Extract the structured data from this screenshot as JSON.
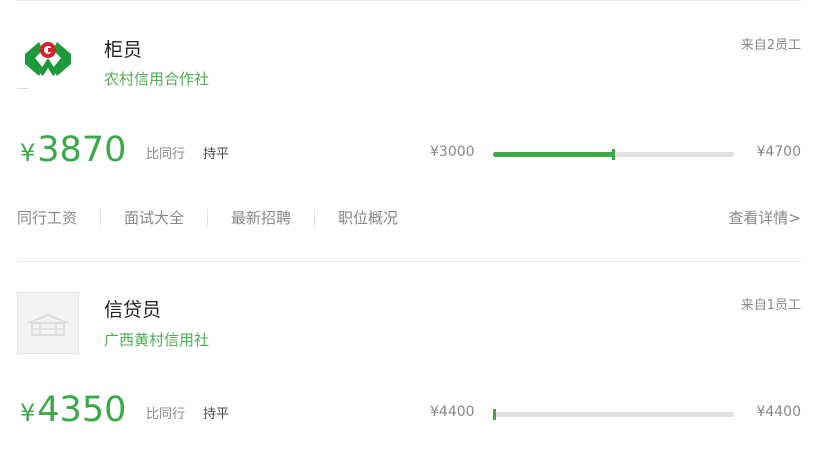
{
  "cards": [
    {
      "title": "柜员",
      "company": "农村信用合作社",
      "source": "来自2员工",
      "logo_icon": "rural-credit-cooperative-logo",
      "currency": "¥",
      "salary": "3870",
      "compare_label": "比同行",
      "compare_value": "持平",
      "range_min": "¥3000",
      "range_max": "¥4700",
      "range_fraction": 0.5,
      "links": [
        "同行工资",
        "面试大全",
        "最新招聘",
        "职位概况"
      ],
      "detail_label": "查看详情>"
    },
    {
      "title": "信贷员",
      "company": "广西黄村信用社",
      "source": "来自1员工",
      "logo_icon": "building-placeholder-icon",
      "currency": "¥",
      "salary": "4350",
      "compare_label": "比同行",
      "compare_value": "持平",
      "range_min": "¥4400",
      "range_max": "¥4400",
      "range_fraction": 0.0
    }
  ],
  "colors": {
    "accent": "#3aaa48",
    "company": "#4caf50",
    "muted": "#888888",
    "track": "#e2e2e2"
  }
}
